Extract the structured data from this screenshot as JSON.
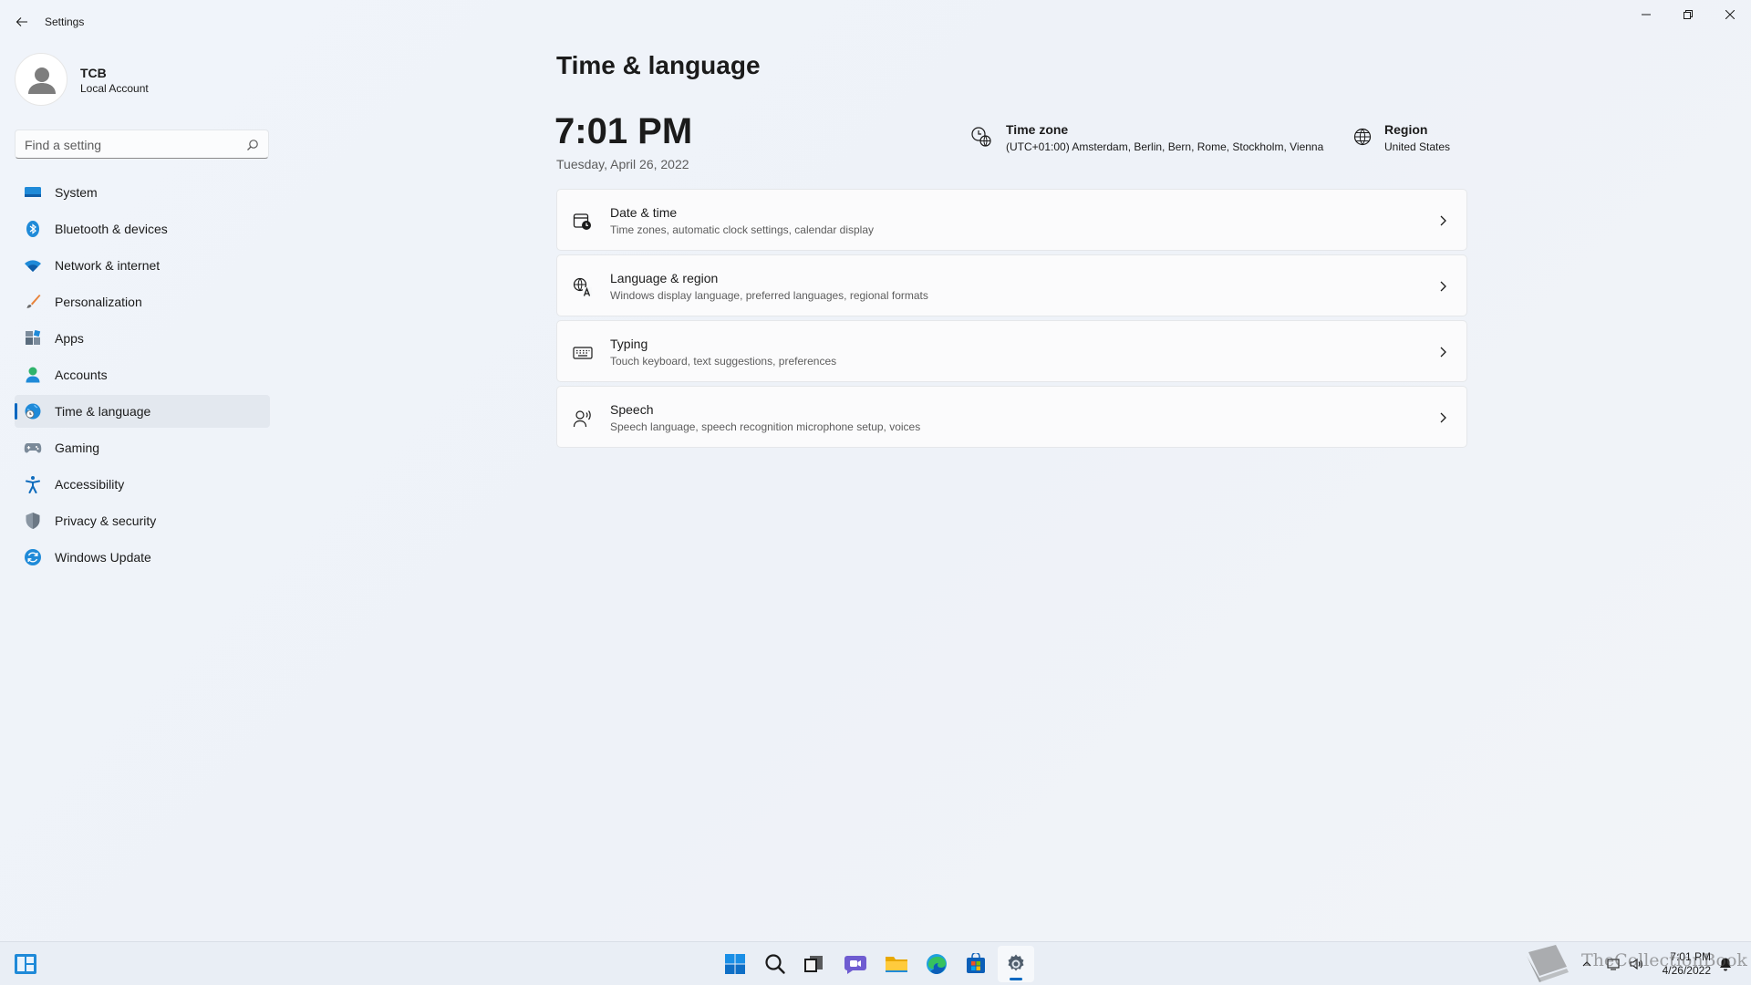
{
  "window": {
    "title": "Settings",
    "back_label": "Back",
    "controls": [
      "Minimize",
      "Restore",
      "Close"
    ]
  },
  "profile": {
    "name": "TCB",
    "account_type": "Local Account"
  },
  "search": {
    "placeholder": "Find a setting"
  },
  "sidebar": {
    "items": [
      {
        "label": "System",
        "icon": "system-icon",
        "color": "#0078d4"
      },
      {
        "label": "Bluetooth & devices",
        "icon": "bluetooth-icon",
        "color": "#0078d4"
      },
      {
        "label": "Network & internet",
        "icon": "wifi-icon",
        "color": "#0078d4"
      },
      {
        "label": "Personalization",
        "icon": "brush-icon",
        "color": "#e8833a"
      },
      {
        "label": "Apps",
        "icon": "apps-icon",
        "color": "#5a6c7d"
      },
      {
        "label": "Accounts",
        "icon": "accounts-icon",
        "color": "#2fb36b"
      },
      {
        "label": "Time & language",
        "icon": "globe-clock-icon",
        "color": "#0078d4",
        "active": true
      },
      {
        "label": "Gaming",
        "icon": "gamepad-icon",
        "color": "#7b8a99"
      },
      {
        "label": "Accessibility",
        "icon": "accessibility-icon",
        "color": "#0f6cbd"
      },
      {
        "label": "Privacy & security",
        "icon": "shield-icon",
        "color": "#7b8794"
      },
      {
        "label": "Windows Update",
        "icon": "update-icon",
        "color": "#0078d4"
      }
    ]
  },
  "main": {
    "title": "Time & language",
    "time": "7:01 PM",
    "date": "Tuesday, April 26, 2022",
    "time_zone": {
      "title": "Time zone",
      "value": "(UTC+01:00) Amsterdam, Berlin, Bern, Rome, Stockholm, Vienna"
    },
    "region": {
      "title": "Region",
      "value": "United States"
    },
    "cards": [
      {
        "title": "Date & time",
        "subtitle": "Time zones, automatic clock settings, calendar display",
        "icon": "calendar-clock-icon"
      },
      {
        "title": "Language & region",
        "subtitle": "Windows display language, preferred languages, regional formats",
        "icon": "language-icon"
      },
      {
        "title": "Typing",
        "subtitle": "Touch keyboard, text suggestions, preferences",
        "icon": "keyboard-icon"
      },
      {
        "title": "Speech",
        "subtitle": "Speech language, speech recognition microphone setup, voices",
        "icon": "speech-icon"
      }
    ]
  },
  "taskbar": {
    "apps": [
      "widgets",
      "start",
      "search",
      "task-view",
      "chat",
      "file-explorer",
      "edge",
      "store",
      "settings"
    ],
    "active_app": "settings",
    "clock_time": "7:01 PM",
    "clock_date": "4/26/2022",
    "watermark": "TheCollectionBook"
  }
}
